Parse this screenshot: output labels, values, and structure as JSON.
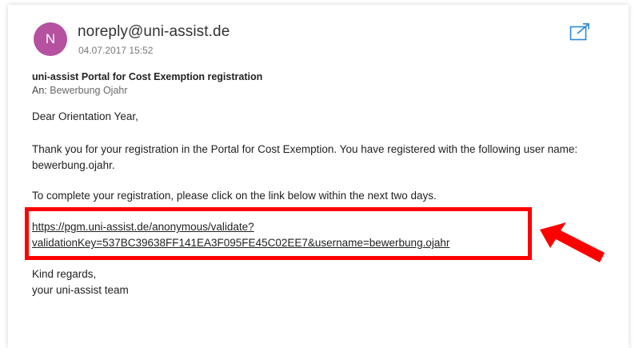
{
  "email": {
    "avatar_initial": "N",
    "sender": "noreply@uni-assist.de",
    "date": "04.07.2017 15:52",
    "subject": "uni-assist Portal for Cost Exemption registration",
    "to_label": "An:",
    "to_name": "Bewerbung Ojahr",
    "greeting": "Dear Orientation Year,",
    "paragraph_thanks": "Thank you for your registration in the Portal for Cost Exemption. You have registered with the following user name: bewerbung.ojahr.",
    "paragraph_complete": "To complete your registration, please click on the link below within the next two days.",
    "link_line1": "https://pgm.uni-assist.de/anonymous/validate?",
    "link_line2": "validationKey=537BC39638FF141EA3F095FE45C02EE7&username=bewerbung.ojahr",
    "regards": "Kind regards,",
    "signature": "your uni-assist team"
  },
  "icons": {
    "popout": "popout-icon",
    "arrow": "arrow-icon"
  },
  "colors": {
    "avatar": "#b5519f",
    "popout_icon": "#2b88d8",
    "highlight": "#ff0000"
  }
}
